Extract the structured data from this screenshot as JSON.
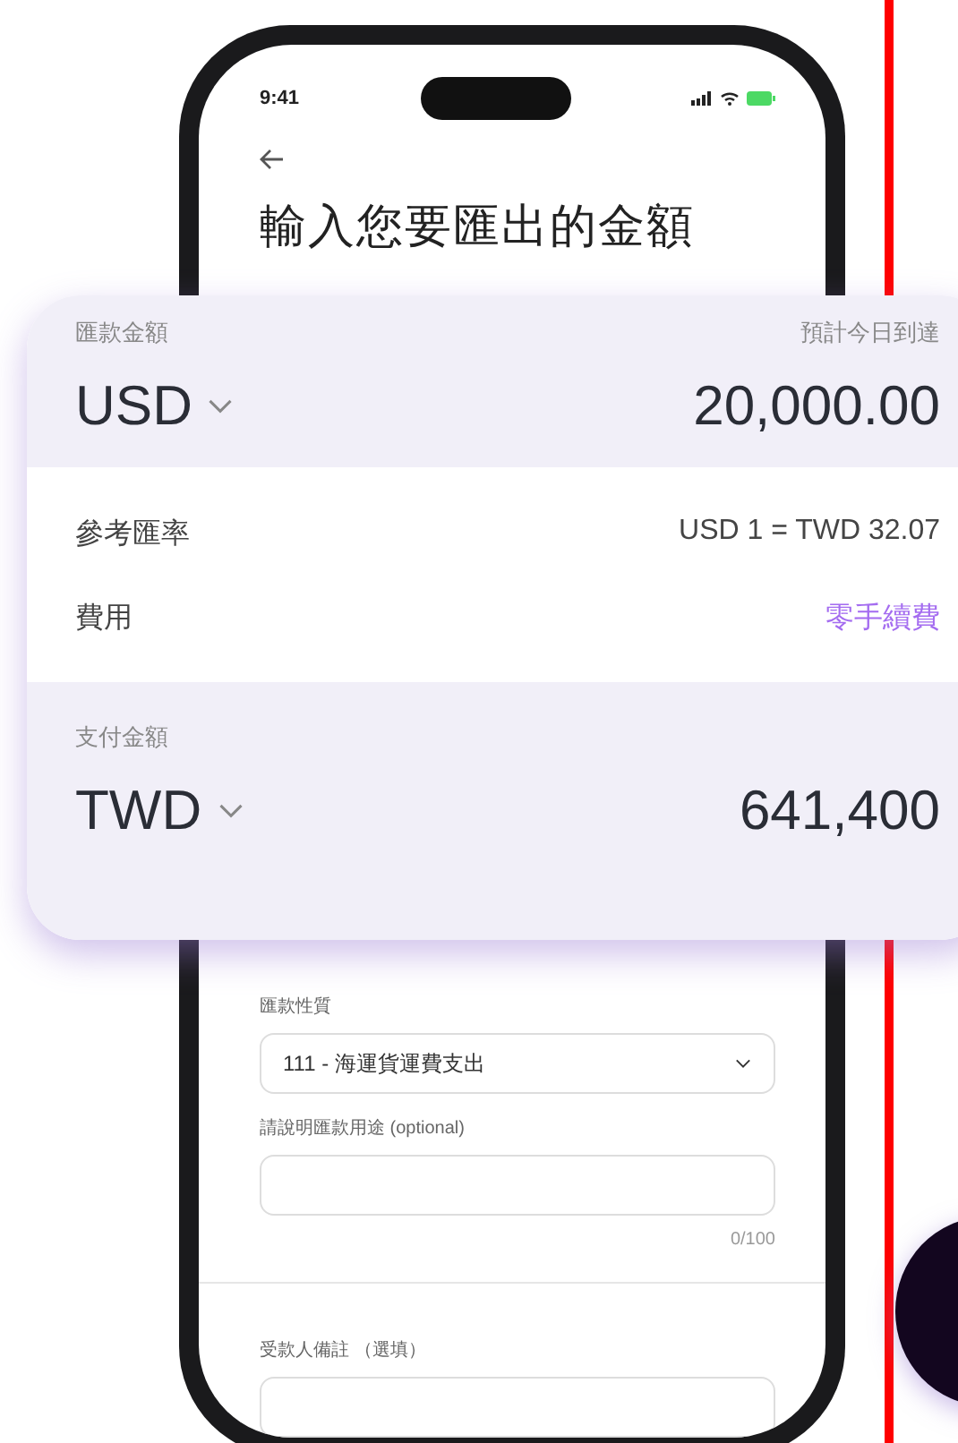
{
  "status_bar": {
    "time": "9:41"
  },
  "screen": {
    "title": "輸入您要匯出的金額"
  },
  "amount_card": {
    "send": {
      "label": "匯款金額",
      "note": "預計今日到達",
      "currency": "USD",
      "amount": "20,000.00"
    },
    "details": [
      {
        "label": "參考匯率",
        "value": "USD 1 = TWD 32.07",
        "kind": "plain"
      },
      {
        "label": "費用",
        "value": "零手續費",
        "kind": "highlight"
      }
    ],
    "pay": {
      "label": "支付金額",
      "currency": "TWD",
      "amount": "641,400"
    }
  },
  "form": {
    "fields": [
      {
        "label": "匯款性質",
        "kind": "select",
        "value": "111 - 海運貨運費支出"
      },
      {
        "label": "請說明匯款用途 (optional)",
        "kind": "text",
        "counter": "0/100"
      },
      {
        "label": "受款人備註 （選填）",
        "kind": "text"
      }
    ]
  }
}
